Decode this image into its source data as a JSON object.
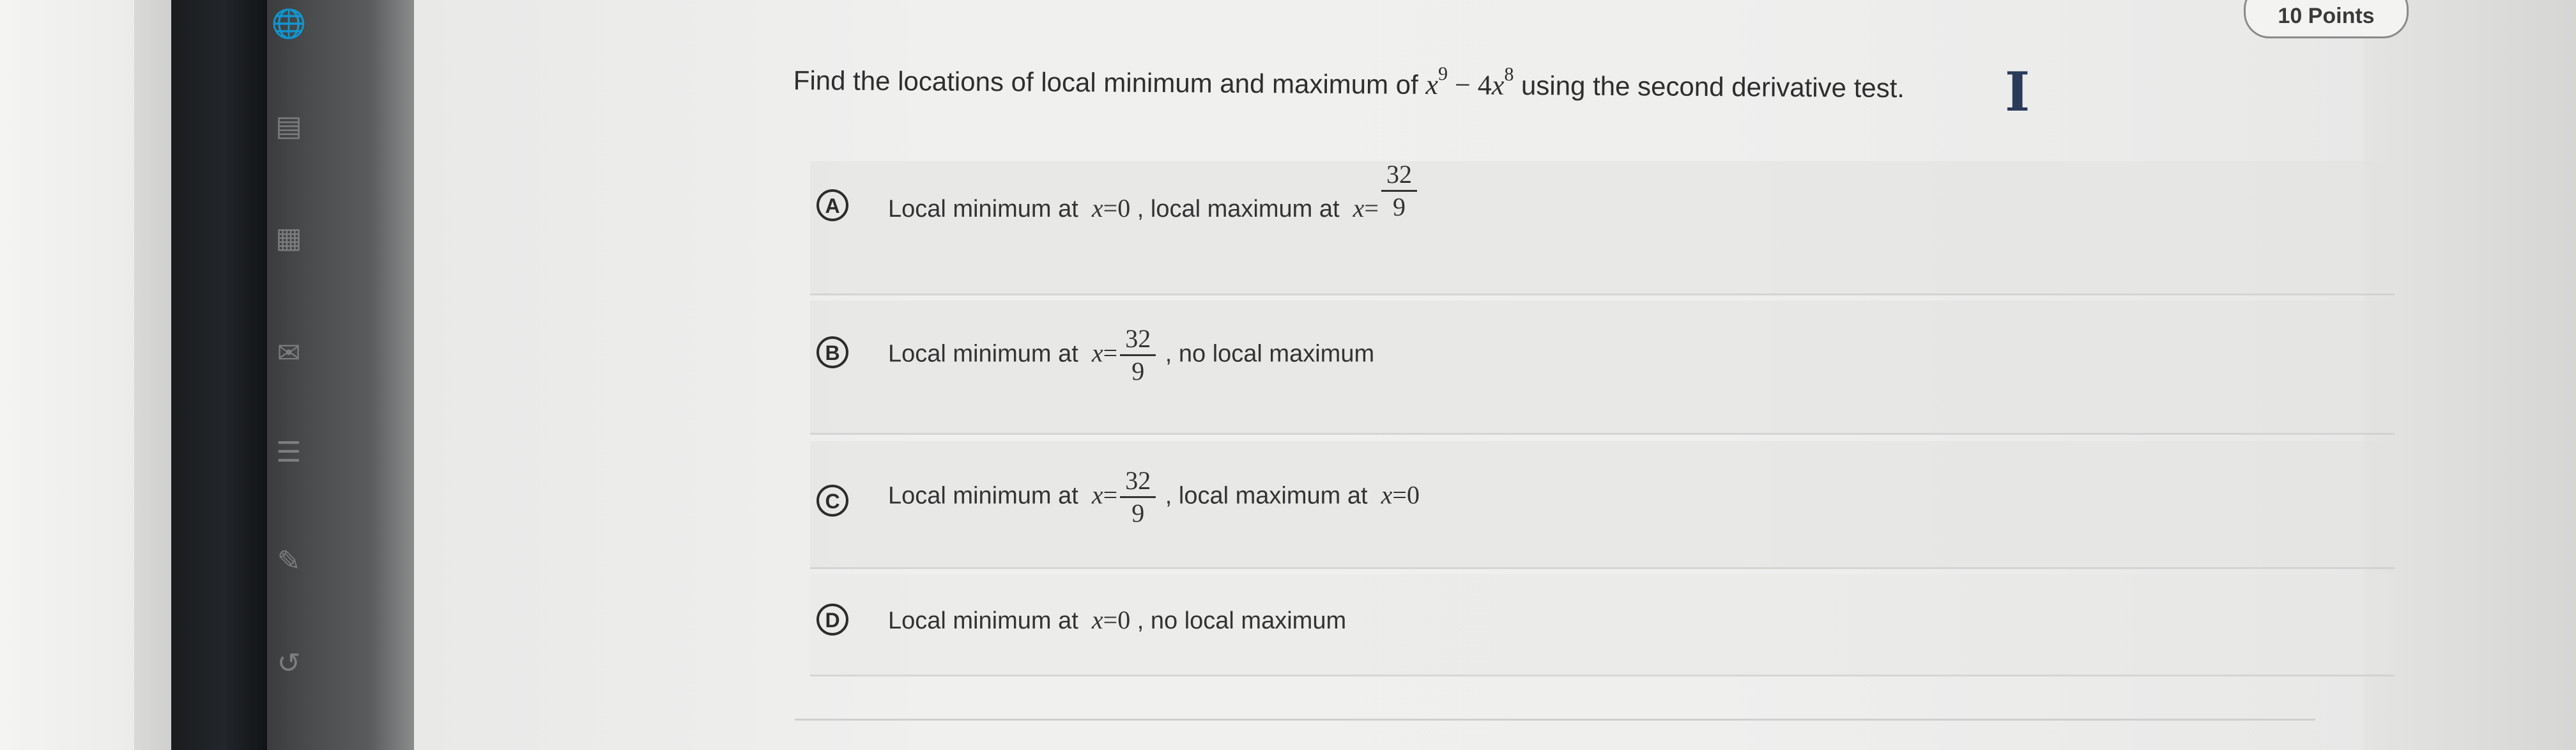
{
  "header": {
    "points_label": "10 Points"
  },
  "question": {
    "prefix": "Find the locations of local minimum and maximum of",
    "func_base1": "x",
    "func_exp1": "9",
    "func_op": " − 4",
    "func_base2": "x",
    "func_exp2": "8",
    "suffix": "using the second derivative test."
  },
  "choices": [
    {
      "letter": "A",
      "t1": "Local minimum at",
      "m1": "x",
      "m1_eq": "=0",
      "t2": ", local maximum at",
      "m2": "x",
      "m2_eq": "=",
      "frac_num": "32",
      "frac_den": "9"
    },
    {
      "letter": "B",
      "t1": "Local minimum at",
      "m1": "x",
      "m1_eq": "=",
      "frac_num": "32",
      "frac_den": "9",
      "t2": ", no local maximum"
    },
    {
      "letter": "C",
      "t1": "Local minimum at",
      "m1": "x",
      "m1_eq": "=",
      "frac_num": "32",
      "frac_den": "9",
      "t2": ", local maximum at",
      "m2": "x",
      "m2_eq": "=0"
    },
    {
      "letter": "D",
      "t1": "Local minimum at",
      "m1": "x",
      "m1_eq": "=0",
      "t2": ", no local maximum"
    }
  ],
  "icons": {
    "cursor": "text-cursor-icon",
    "rail": [
      "globe-icon",
      "document-icon",
      "calculator-icon",
      "mail-icon",
      "notes-icon",
      "edit-icon",
      "history-icon"
    ]
  }
}
